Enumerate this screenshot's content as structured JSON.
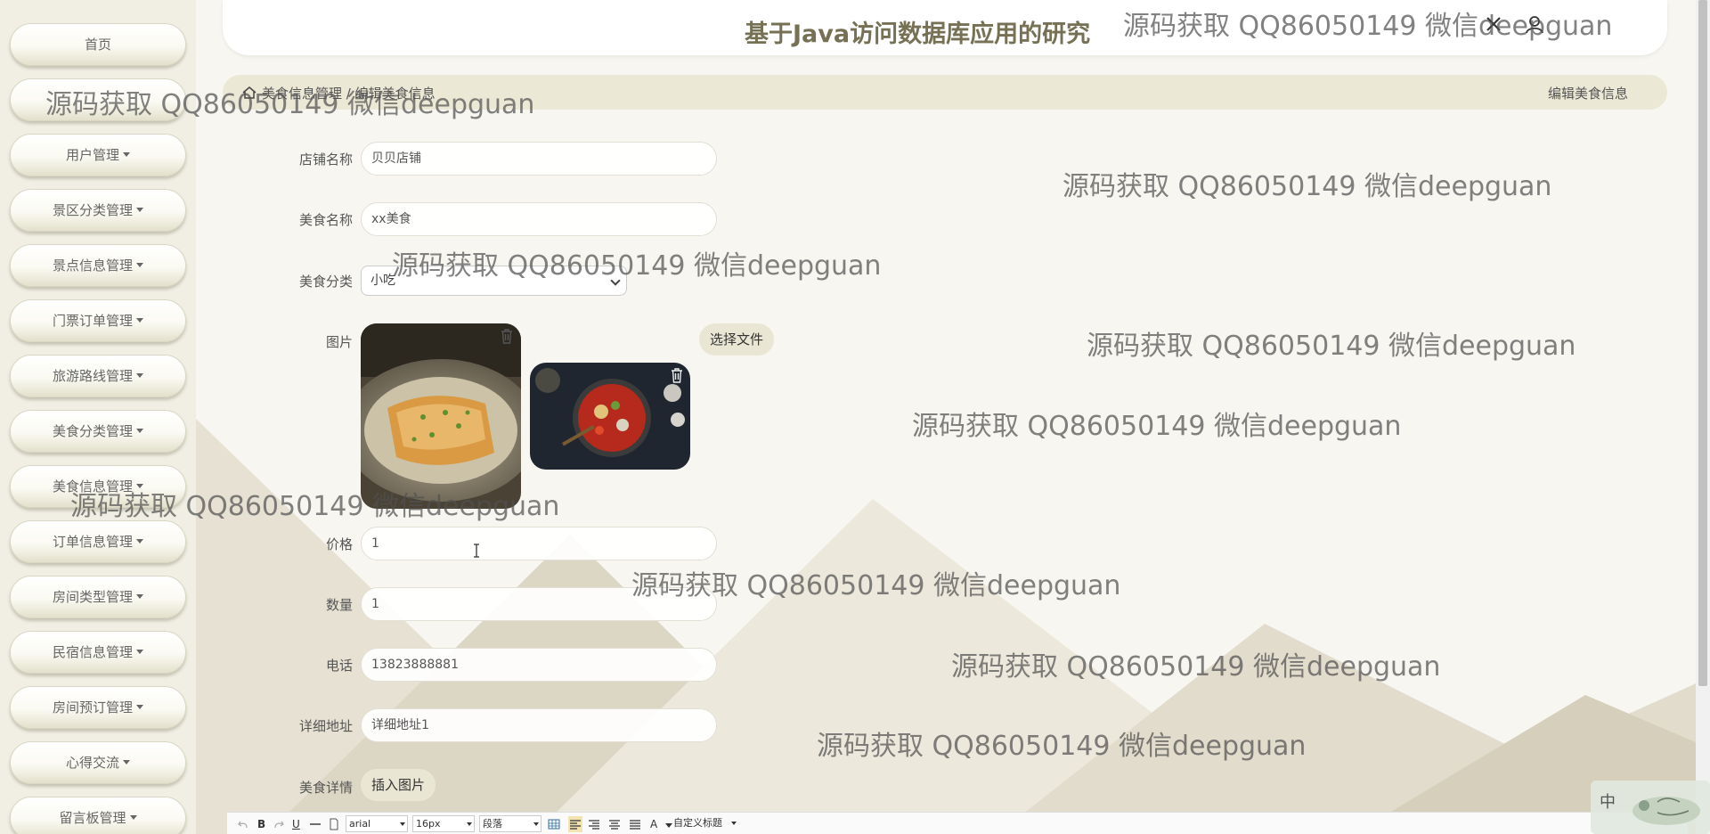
{
  "app": {
    "title": "基于Java访问数据库应用的研究"
  },
  "sidebar": {
    "items": [
      {
        "label": "首页",
        "dropdown": false
      },
      {
        "label": "",
        "dropdown": false
      },
      {
        "label": "用户管理",
        "dropdown": true
      },
      {
        "label": "景区分类管理",
        "dropdown": true
      },
      {
        "label": "景点信息管理",
        "dropdown": true
      },
      {
        "label": "门票订单管理",
        "dropdown": true
      },
      {
        "label": "旅游路线管理",
        "dropdown": true
      },
      {
        "label": "美食分类管理",
        "dropdown": true
      },
      {
        "label": "美食信息管理",
        "dropdown": true
      },
      {
        "label": "订单信息管理",
        "dropdown": true
      },
      {
        "label": "房间类型管理",
        "dropdown": true
      },
      {
        "label": "民宿信息管理",
        "dropdown": true
      },
      {
        "label": "房间预订管理",
        "dropdown": true
      },
      {
        "label": "心得交流",
        "dropdown": true
      },
      {
        "label": "留言板管理",
        "dropdown": true
      }
    ]
  },
  "breadcrumb": {
    "path": "美食信息管理 / 编辑美食信息",
    "page_title": "编辑美食信息"
  },
  "form": {
    "shop_name": {
      "label": "店铺名称",
      "value": "贝贝店铺"
    },
    "food_name": {
      "label": "美食名称",
      "value": "xx美食"
    },
    "category": {
      "label": "美食分类",
      "value": "小吃"
    },
    "image": {
      "label": "图片",
      "choose_file": "选择文件"
    },
    "price": {
      "label": "价格",
      "value": "1"
    },
    "quantity": {
      "label": "数量",
      "value": "1"
    },
    "phone": {
      "label": "电话",
      "value": "13823888881"
    },
    "address": {
      "label": "详细地址",
      "value": "详细地址1"
    },
    "details": {
      "label": "美食详情",
      "insert_image": "插入图片"
    }
  },
  "editor_toolbar": {
    "bold": "B",
    "underline": "U",
    "font_family": "arial",
    "font_size": "16px",
    "paragraph": "段落",
    "font_color": "A",
    "custom_title": "自定义标题"
  },
  "ime": {
    "mode": "中"
  },
  "watermark": {
    "text": "源码获取 QQ86050149 微信deepguan"
  },
  "colors": {
    "accent": "#767154",
    "sidebar_bg": "#f1efe4",
    "breadcrumb_bg": "#ebe8d6",
    "button_bg": "#e9e6d3"
  }
}
